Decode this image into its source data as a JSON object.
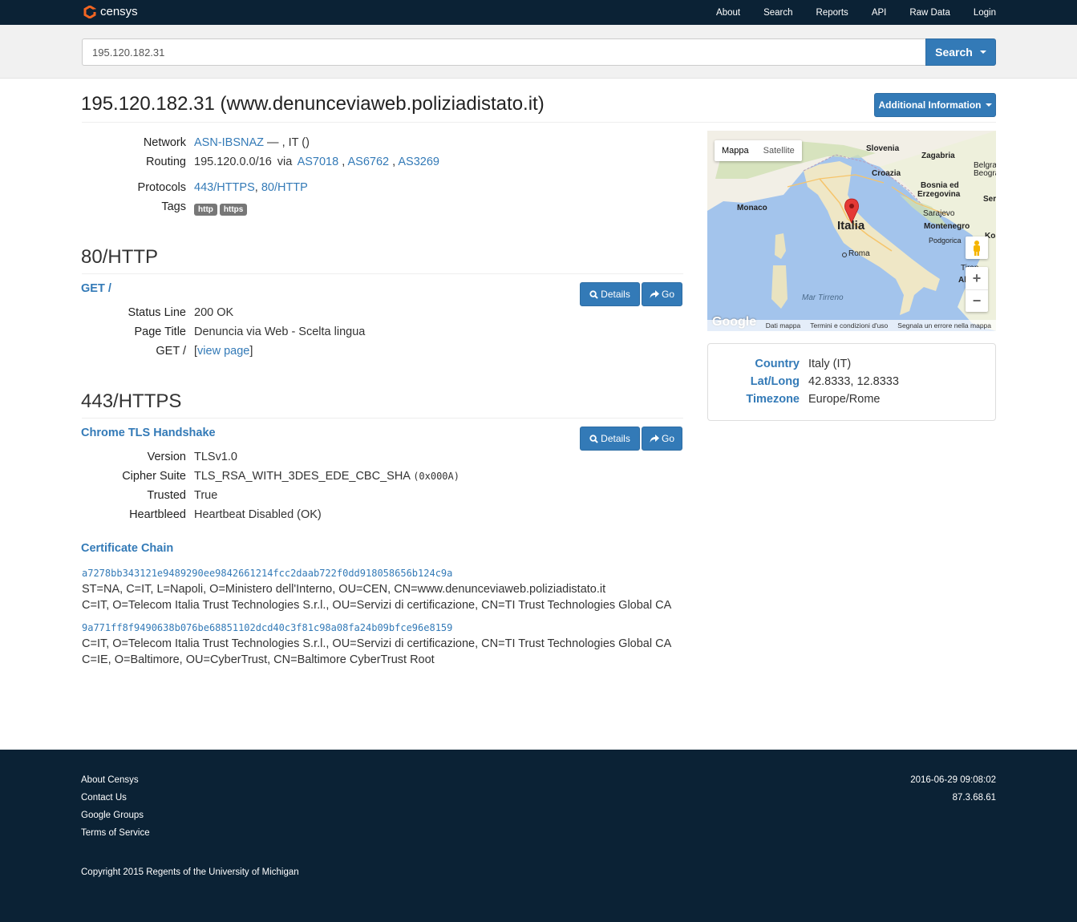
{
  "nav": {
    "brand": "censys",
    "links": [
      "About",
      "Search",
      "Reports",
      "API",
      "Raw Data",
      "Login"
    ]
  },
  "search": {
    "value": "195.120.182.31",
    "button": "Search"
  },
  "title": "195.120.182.31 (www.denunceviaweb.poliziadistato.it)",
  "additional_button": "Additional Information",
  "summary": {
    "network_label": "Network",
    "network_link": "ASN-IBSNAZ",
    "network_rest": " —  , IT ()",
    "routing_label": "Routing",
    "routing_prefix": "195.120.0.0/16",
    "routing_via": "via",
    "routing_as": [
      "AS7018",
      "AS6762",
      "AS3269"
    ],
    "protocols_label": "Protocols",
    "protocols": [
      "443/HTTPS",
      "80/HTTP"
    ],
    "tags_label": "Tags",
    "tags": [
      "http",
      "https"
    ]
  },
  "http": {
    "heading": "80/HTTP",
    "sub": "GET /",
    "details_btn": "Details",
    "go_btn": "Go",
    "rows": [
      {
        "k": "Status Line",
        "v": "200 OK"
      },
      {
        "k": "Page Title",
        "v": "Denuncia via Web - Scelta lingua"
      }
    ],
    "get_label": "GET /",
    "view_page": "view page"
  },
  "https": {
    "heading": "443/HTTPS",
    "sub": "Chrome TLS Handshake",
    "details_btn": "Details",
    "go_btn": "Go",
    "rows": [
      {
        "k": "Version",
        "v": "TLSv1.0"
      },
      {
        "k": "Cipher Suite",
        "v": "TLS_RSA_WITH_3DES_EDE_CBC_SHA"
      },
      {
        "k": "Trusted",
        "v": "True"
      },
      {
        "k": "Heartbleed",
        "v": "Heartbeat Disabled (OK)"
      }
    ],
    "cipher_code": "(0x000A)",
    "cert_chain_heading": "Certificate Chain",
    "certs": [
      {
        "hash": "a7278bb343121e9489290ee9842661214fcc2daab722f0dd918058656b124c9a",
        "subject": "ST=NA, C=IT, L=Napoli, O=Ministero dell'Interno, OU=CEN, CN=www.denunceviaweb.poliziadistato.it",
        "issuer": "C=IT, O=Telecom Italia Trust Technologies S.r.l., OU=Servizi di certificazione, CN=TI Trust Technologies Global CA"
      },
      {
        "hash": "9a771ff8f9490638b076be68851102dcd40c3f81c98a08fa24b09bfce96e8159",
        "subject": "C=IT, O=Telecom Italia Trust Technologies S.r.l., OU=Servizi di certificazione, CN=TI Trust Technologies Global CA",
        "issuer": "C=IE, O=Baltimore, OU=CyberTrust, CN=Baltimore CyberTrust Root"
      }
    ]
  },
  "map": {
    "tabs": [
      "Mappa",
      "Satellite"
    ],
    "labels": {
      "slovenia": "Slovenia",
      "zagabria": "Zagabria",
      "croazia": "Croazia",
      "bosnia": "Bosnia ed",
      "erzegovina": "Erzegovina",
      "sarajevo": "Sarajevo",
      "montenegro": "Montenegro",
      "podgorica": "Podgorica",
      "monaco": "Monaco",
      "italia": "Italia",
      "roma": "Roma",
      "mar_tirreno": "Mar Tirreno",
      "belgrado": "Belgra",
      "beograd": "Beograd",
      "tirana": "Tiran",
      "albania": "All",
      "kos": "Kos",
      "ser": "Ser"
    },
    "footer": [
      "Dati mappa",
      "Termini e condizioni d'uso",
      "Segnala un errore nella mappa"
    ],
    "google": "Google"
  },
  "geo": {
    "rows": [
      {
        "k": "Country",
        "v": "Italy (IT)"
      },
      {
        "k": "Lat/Long",
        "v": "42.8333, 12.8333"
      },
      {
        "k": "Timezone",
        "v": "Europe/Rome"
      }
    ]
  },
  "footer": {
    "links": [
      "About Censys",
      "Contact Us",
      "Google Groups",
      "Terms of Service"
    ],
    "timestamp": "2016-06-29 09:08:02",
    "ip": "87.3.68.61",
    "copyright": "Copyright 2015 Regents of the University of Michigan"
  }
}
